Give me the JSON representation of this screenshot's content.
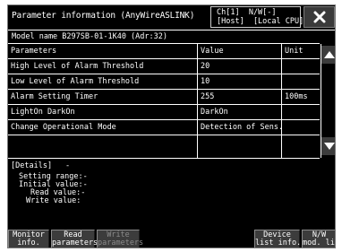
{
  "window": {
    "title": "Parameter information (AnyWireASLINK)",
    "channel_line1": "Ch[1]  N/W[-]",
    "channel_line2": "[Host]  [Local CPU]"
  },
  "model": {
    "text": "Model name B297SB-01-1K40 (Adr:32)"
  },
  "table": {
    "headers": {
      "param": "Parameters",
      "value": "Value",
      "unit": "Unit"
    },
    "rows": [
      {
        "param": "High Level of Alarm Threshold",
        "value": "20",
        "unit": ""
      },
      {
        "param": "Low Level of Alarm Threshold",
        "value": "10",
        "unit": ""
      },
      {
        "param": "Alarm Setting Timer",
        "value": "255",
        "unit": "100ms"
      },
      {
        "param": "LightOn DarkOn",
        "value": "DarkOn",
        "unit": ""
      },
      {
        "param": "Change Operational Mode",
        "value": "Detection of Sens..",
        "unit": ""
      },
      {
        "param": "",
        "value": "",
        "unit": ""
      }
    ]
  },
  "details": {
    "header": "[Details]",
    "dash": "-",
    "setting_range": "Setting range:-",
    "initial_value": "Initial value:-",
    "read_value": "Read value:-",
    "write_value": "Write value:"
  },
  "buttons": {
    "monitor_l1": "Monitor",
    "monitor_l2": "info.",
    "read_l1": "Read",
    "read_l2": "parameters",
    "write_l1": "Write",
    "write_l2": "parameters",
    "device_l1": "Device",
    "device_l2": "list info.",
    "nw_l1": "N/W",
    "nw_l2": "mod. list"
  },
  "icons": {
    "close": "close-icon",
    "scroll_up": "triangle-up-icon",
    "scroll_down": "triangle-down-icon"
  },
  "colors": {
    "background": "#000000",
    "foreground": "#ffffff",
    "button": "#3c3c3c",
    "disabled_text": "#8c8c8c"
  }
}
